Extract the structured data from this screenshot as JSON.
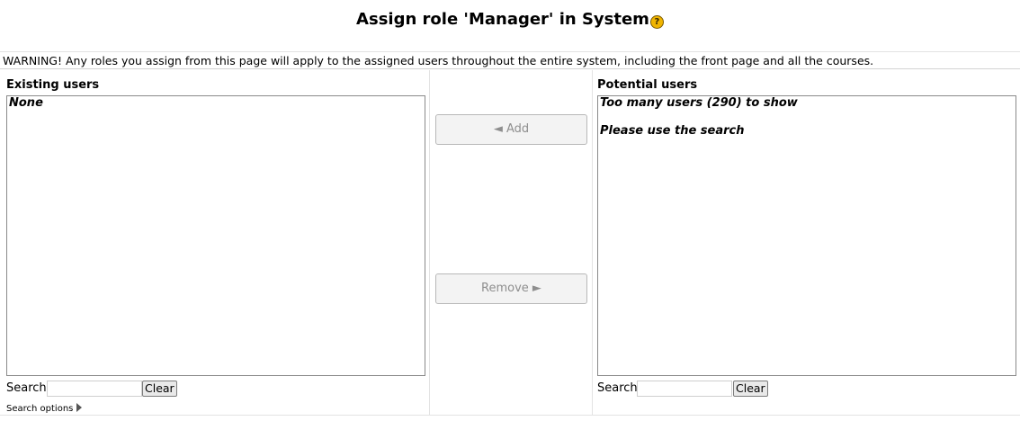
{
  "page": {
    "title": "Assign role 'Manager' in System",
    "help_icon_glyph": "?",
    "warning": "WARNING! Any roles you assign from this page will apply to the assigned users throughout the entire system, including the front page and all the courses."
  },
  "existing": {
    "label": "Existing users",
    "options": [
      "None"
    ],
    "search_label": "Search",
    "search_value": "",
    "clear_label": "Clear"
  },
  "actions": {
    "add_label": "◄ Add",
    "remove_label": "Remove ►"
  },
  "potential": {
    "label": "Potential users",
    "options": [
      "Too many users (290) to show",
      "",
      "Please use the search"
    ],
    "search_label": "Search",
    "search_value": "",
    "clear_label": "Clear"
  },
  "search_options_label": "Search options",
  "colors": {
    "help_icon": "#f0b400",
    "disabled_button_text": "#8e8e8e",
    "border": "#e3e3e3"
  }
}
